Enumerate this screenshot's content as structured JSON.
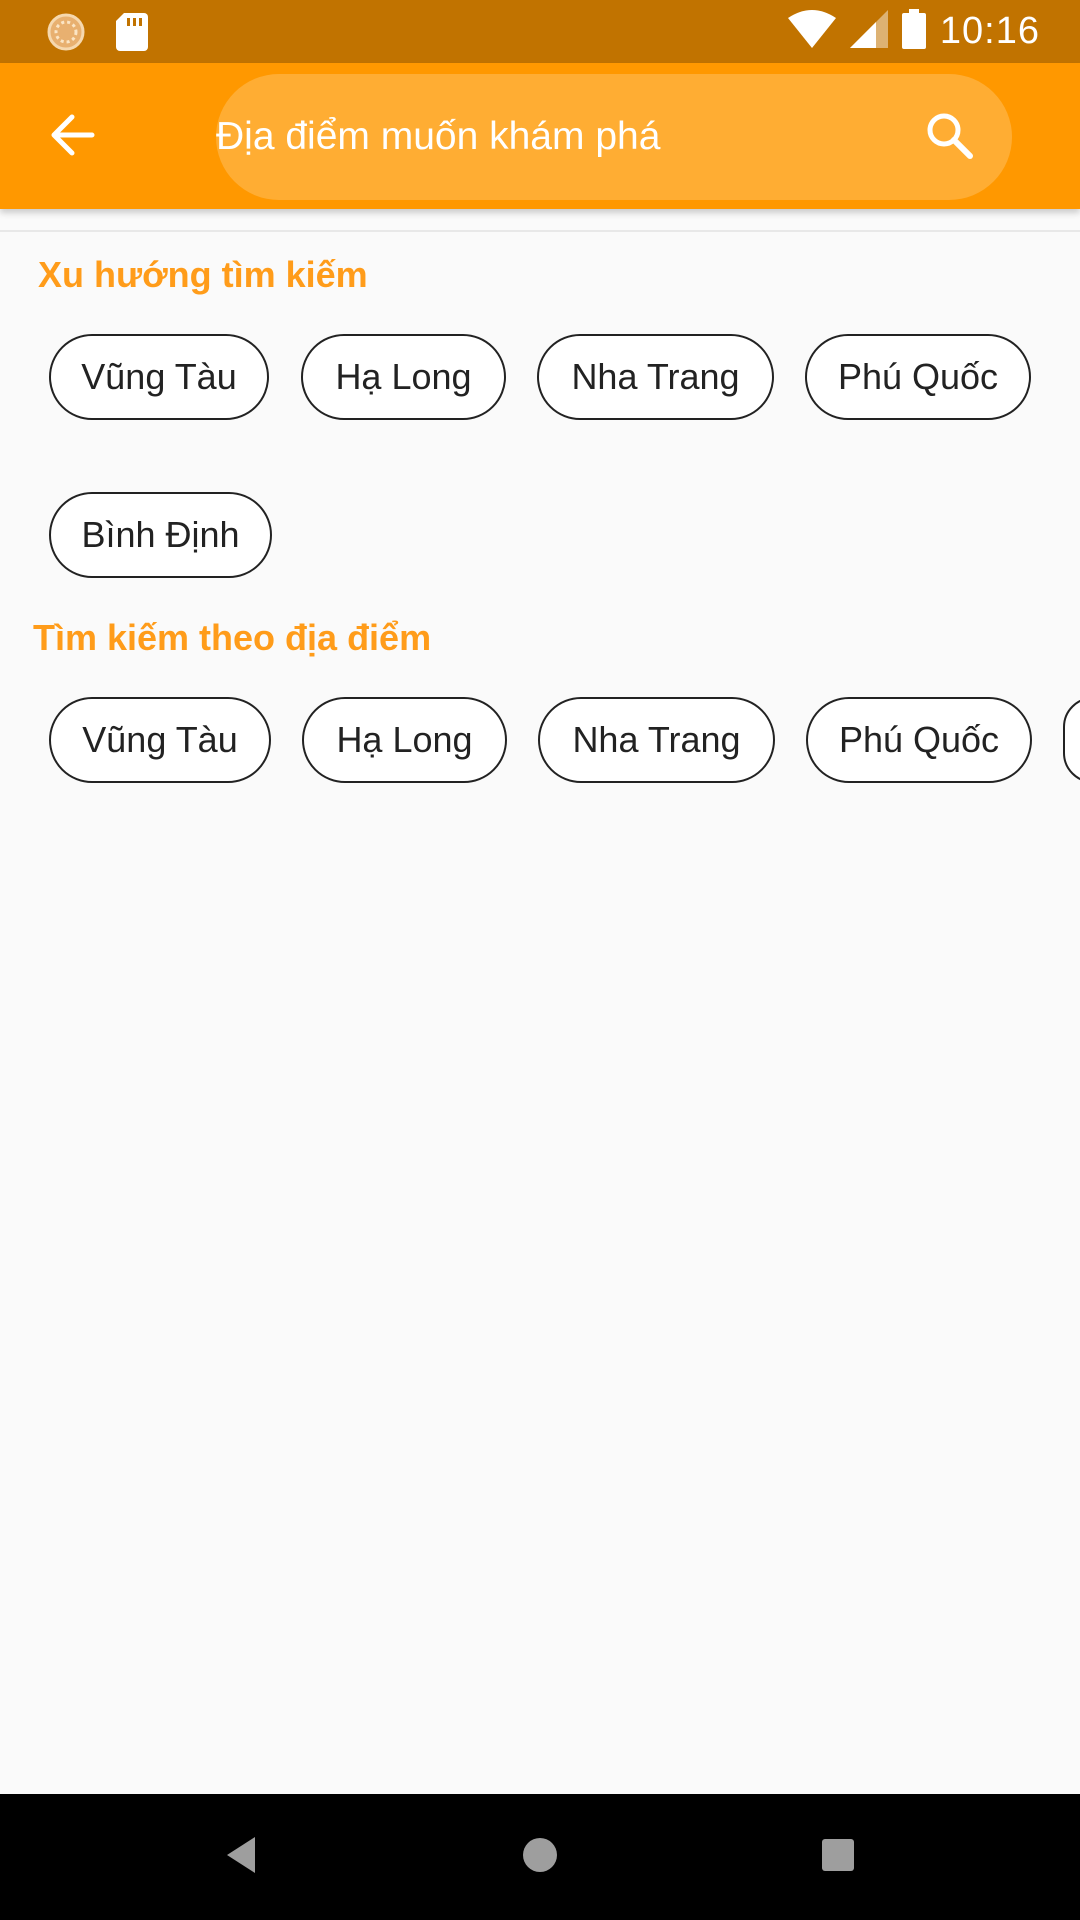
{
  "status_bar": {
    "time": "10:16",
    "icons": [
      "sync-icon",
      "sd-card-icon",
      "wifi-icon",
      "signal-icon",
      "battery-icon"
    ]
  },
  "app_bar": {
    "back_icon": "arrow-back-icon",
    "search_placeholder": "Địa điểm muốn khám phá",
    "search_icon": "search-icon"
  },
  "sections": {
    "trending": {
      "title": "Xu hướng tìm kiếm",
      "chips": [
        "Vũng Tàu",
        "Hạ Long",
        "Nha Trang",
        "Phú Quốc",
        "Bình Định"
      ]
    },
    "by_location": {
      "title": "Tìm kiếm theo địa điểm",
      "chips": [
        "Vũng Tàu",
        "Hạ Long",
        "Nha Trang",
        "Phú Quốc"
      ]
    }
  },
  "nav_bar": {
    "icons": [
      "back-triangle-icon",
      "home-circle-icon",
      "recents-square-icon"
    ]
  },
  "colors": {
    "status_bar": "#c17300",
    "app_bar": "#ff9800",
    "search_box": "#ffad33",
    "section_title": "#ff9c1a"
  }
}
